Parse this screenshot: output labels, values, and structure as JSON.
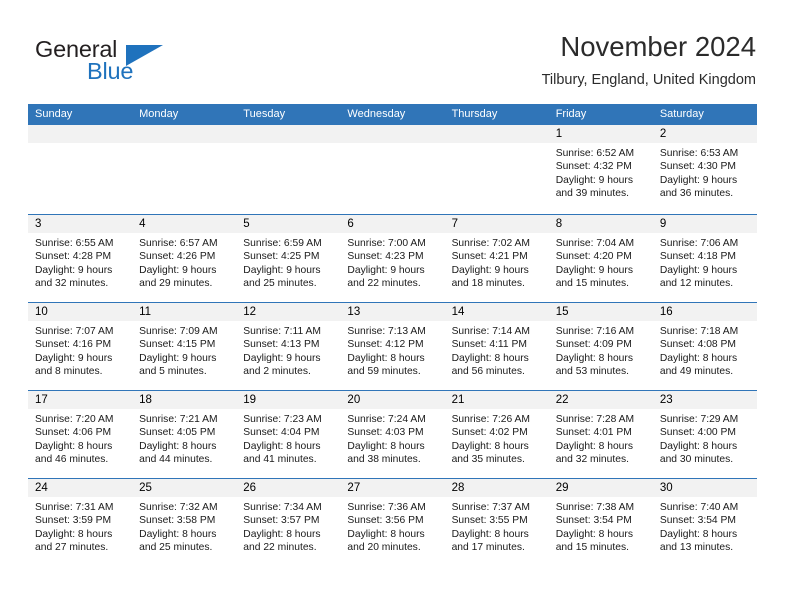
{
  "brand": {
    "name_part1": "General",
    "name_part2": "Blue",
    "accent_color": "#1f72bd"
  },
  "header": {
    "title": "November 2024",
    "subtitle": "Tilbury, England, United Kingdom"
  },
  "calendar": {
    "header_color": "#3075b8",
    "weekdays": [
      "Sunday",
      "Monday",
      "Tuesday",
      "Wednesday",
      "Thursday",
      "Friday",
      "Saturday"
    ],
    "weeks": [
      [
        {
          "day": "",
          "sunrise": "",
          "sunset": "",
          "daylight_line1": "",
          "daylight_line2": ""
        },
        {
          "day": "",
          "sunrise": "",
          "sunset": "",
          "daylight_line1": "",
          "daylight_line2": ""
        },
        {
          "day": "",
          "sunrise": "",
          "sunset": "",
          "daylight_line1": "",
          "daylight_line2": ""
        },
        {
          "day": "",
          "sunrise": "",
          "sunset": "",
          "daylight_line1": "",
          "daylight_line2": ""
        },
        {
          "day": "",
          "sunrise": "",
          "sunset": "",
          "daylight_line1": "",
          "daylight_line2": ""
        },
        {
          "day": "1",
          "sunrise": "Sunrise: 6:52 AM",
          "sunset": "Sunset: 4:32 PM",
          "daylight_line1": "Daylight: 9 hours",
          "daylight_line2": "and 39 minutes."
        },
        {
          "day": "2",
          "sunrise": "Sunrise: 6:53 AM",
          "sunset": "Sunset: 4:30 PM",
          "daylight_line1": "Daylight: 9 hours",
          "daylight_line2": "and 36 minutes."
        }
      ],
      [
        {
          "day": "3",
          "sunrise": "Sunrise: 6:55 AM",
          "sunset": "Sunset: 4:28 PM",
          "daylight_line1": "Daylight: 9 hours",
          "daylight_line2": "and 32 minutes."
        },
        {
          "day": "4",
          "sunrise": "Sunrise: 6:57 AM",
          "sunset": "Sunset: 4:26 PM",
          "daylight_line1": "Daylight: 9 hours",
          "daylight_line2": "and 29 minutes."
        },
        {
          "day": "5",
          "sunrise": "Sunrise: 6:59 AM",
          "sunset": "Sunset: 4:25 PM",
          "daylight_line1": "Daylight: 9 hours",
          "daylight_line2": "and 25 minutes."
        },
        {
          "day": "6",
          "sunrise": "Sunrise: 7:00 AM",
          "sunset": "Sunset: 4:23 PM",
          "daylight_line1": "Daylight: 9 hours",
          "daylight_line2": "and 22 minutes."
        },
        {
          "day": "7",
          "sunrise": "Sunrise: 7:02 AM",
          "sunset": "Sunset: 4:21 PM",
          "daylight_line1": "Daylight: 9 hours",
          "daylight_line2": "and 18 minutes."
        },
        {
          "day": "8",
          "sunrise": "Sunrise: 7:04 AM",
          "sunset": "Sunset: 4:20 PM",
          "daylight_line1": "Daylight: 9 hours",
          "daylight_line2": "and 15 minutes."
        },
        {
          "day": "9",
          "sunrise": "Sunrise: 7:06 AM",
          "sunset": "Sunset: 4:18 PM",
          "daylight_line1": "Daylight: 9 hours",
          "daylight_line2": "and 12 minutes."
        }
      ],
      [
        {
          "day": "10",
          "sunrise": "Sunrise: 7:07 AM",
          "sunset": "Sunset: 4:16 PM",
          "daylight_line1": "Daylight: 9 hours",
          "daylight_line2": "and 8 minutes."
        },
        {
          "day": "11",
          "sunrise": "Sunrise: 7:09 AM",
          "sunset": "Sunset: 4:15 PM",
          "daylight_line1": "Daylight: 9 hours",
          "daylight_line2": "and 5 minutes."
        },
        {
          "day": "12",
          "sunrise": "Sunrise: 7:11 AM",
          "sunset": "Sunset: 4:13 PM",
          "daylight_line1": "Daylight: 9 hours",
          "daylight_line2": "and 2 minutes."
        },
        {
          "day": "13",
          "sunrise": "Sunrise: 7:13 AM",
          "sunset": "Sunset: 4:12 PM",
          "daylight_line1": "Daylight: 8 hours",
          "daylight_line2": "and 59 minutes."
        },
        {
          "day": "14",
          "sunrise": "Sunrise: 7:14 AM",
          "sunset": "Sunset: 4:11 PM",
          "daylight_line1": "Daylight: 8 hours",
          "daylight_line2": "and 56 minutes."
        },
        {
          "day": "15",
          "sunrise": "Sunrise: 7:16 AM",
          "sunset": "Sunset: 4:09 PM",
          "daylight_line1": "Daylight: 8 hours",
          "daylight_line2": "and 53 minutes."
        },
        {
          "day": "16",
          "sunrise": "Sunrise: 7:18 AM",
          "sunset": "Sunset: 4:08 PM",
          "daylight_line1": "Daylight: 8 hours",
          "daylight_line2": "and 49 minutes."
        }
      ],
      [
        {
          "day": "17",
          "sunrise": "Sunrise: 7:20 AM",
          "sunset": "Sunset: 4:06 PM",
          "daylight_line1": "Daylight: 8 hours",
          "daylight_line2": "and 46 minutes."
        },
        {
          "day": "18",
          "sunrise": "Sunrise: 7:21 AM",
          "sunset": "Sunset: 4:05 PM",
          "daylight_line1": "Daylight: 8 hours",
          "daylight_line2": "and 44 minutes."
        },
        {
          "day": "19",
          "sunrise": "Sunrise: 7:23 AM",
          "sunset": "Sunset: 4:04 PM",
          "daylight_line1": "Daylight: 8 hours",
          "daylight_line2": "and 41 minutes."
        },
        {
          "day": "20",
          "sunrise": "Sunrise: 7:24 AM",
          "sunset": "Sunset: 4:03 PM",
          "daylight_line1": "Daylight: 8 hours",
          "daylight_line2": "and 38 minutes."
        },
        {
          "day": "21",
          "sunrise": "Sunrise: 7:26 AM",
          "sunset": "Sunset: 4:02 PM",
          "daylight_line1": "Daylight: 8 hours",
          "daylight_line2": "and 35 minutes."
        },
        {
          "day": "22",
          "sunrise": "Sunrise: 7:28 AM",
          "sunset": "Sunset: 4:01 PM",
          "daylight_line1": "Daylight: 8 hours",
          "daylight_line2": "and 32 minutes."
        },
        {
          "day": "23",
          "sunrise": "Sunrise: 7:29 AM",
          "sunset": "Sunset: 4:00 PM",
          "daylight_line1": "Daylight: 8 hours",
          "daylight_line2": "and 30 minutes."
        }
      ],
      [
        {
          "day": "24",
          "sunrise": "Sunrise: 7:31 AM",
          "sunset": "Sunset: 3:59 PM",
          "daylight_line1": "Daylight: 8 hours",
          "daylight_line2": "and 27 minutes."
        },
        {
          "day": "25",
          "sunrise": "Sunrise: 7:32 AM",
          "sunset": "Sunset: 3:58 PM",
          "daylight_line1": "Daylight: 8 hours",
          "daylight_line2": "and 25 minutes."
        },
        {
          "day": "26",
          "sunrise": "Sunrise: 7:34 AM",
          "sunset": "Sunset: 3:57 PM",
          "daylight_line1": "Daylight: 8 hours",
          "daylight_line2": "and 22 minutes."
        },
        {
          "day": "27",
          "sunrise": "Sunrise: 7:36 AM",
          "sunset": "Sunset: 3:56 PM",
          "daylight_line1": "Daylight: 8 hours",
          "daylight_line2": "and 20 minutes."
        },
        {
          "day": "28",
          "sunrise": "Sunrise: 7:37 AM",
          "sunset": "Sunset: 3:55 PM",
          "daylight_line1": "Daylight: 8 hours",
          "daylight_line2": "and 17 minutes."
        },
        {
          "day": "29",
          "sunrise": "Sunrise: 7:38 AM",
          "sunset": "Sunset: 3:54 PM",
          "daylight_line1": "Daylight: 8 hours",
          "daylight_line2": "and 15 minutes."
        },
        {
          "day": "30",
          "sunrise": "Sunrise: 7:40 AM",
          "sunset": "Sunset: 3:54 PM",
          "daylight_line1": "Daylight: 8 hours",
          "daylight_line2": "and 13 minutes."
        }
      ]
    ]
  }
}
